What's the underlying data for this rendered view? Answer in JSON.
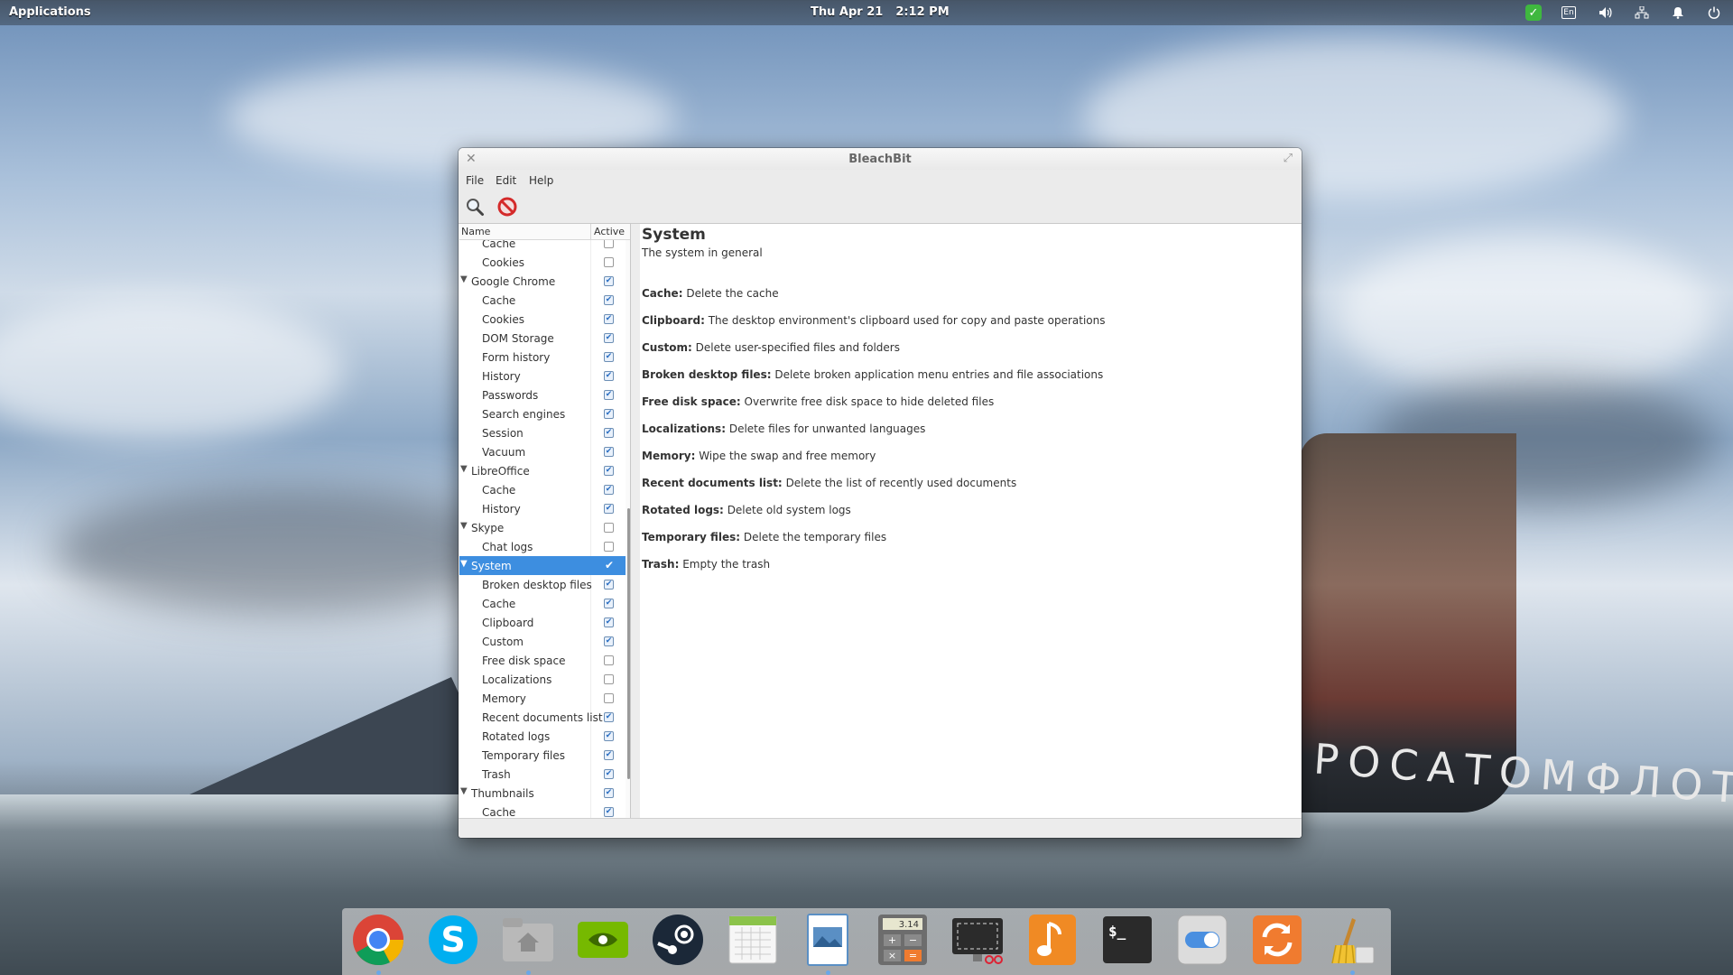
{
  "top_panel": {
    "applications_label": "Applications",
    "date": "Thu Apr 21",
    "time": "2:12 PM",
    "lang_indicator": "En",
    "indicators": [
      "check-icon",
      "keyboard-layout-icon",
      "volume-icon",
      "network-icon",
      "notification-bell-icon",
      "power-icon"
    ]
  },
  "window": {
    "title": "BleachBit",
    "menu": {
      "file": "File",
      "edit": "Edit",
      "help": "Help"
    },
    "toolbar": [
      "preview-search-icon",
      "stop-delete-icon"
    ]
  },
  "tree": {
    "headers": {
      "name": "Name",
      "active": "Active"
    },
    "rows": [
      {
        "label": "Cache",
        "level": 1,
        "checked": false
      },
      {
        "label": "Cookies",
        "level": 1,
        "checked": false
      },
      {
        "label": "Google Chrome",
        "level": 0,
        "expanded": true,
        "checked": true
      },
      {
        "label": "Cache",
        "level": 1,
        "checked": true
      },
      {
        "label": "Cookies",
        "level": 1,
        "checked": true
      },
      {
        "label": "DOM Storage",
        "level": 1,
        "checked": true
      },
      {
        "label": "Form history",
        "level": 1,
        "checked": true
      },
      {
        "label": "History",
        "level": 1,
        "checked": true
      },
      {
        "label": "Passwords",
        "level": 1,
        "checked": true
      },
      {
        "label": "Search engines",
        "level": 1,
        "checked": true
      },
      {
        "label": "Session",
        "level": 1,
        "checked": true
      },
      {
        "label": "Vacuum",
        "level": 1,
        "checked": true
      },
      {
        "label": "LibreOffice",
        "level": 0,
        "expanded": true,
        "checked": true
      },
      {
        "label": "Cache",
        "level": 1,
        "checked": true
      },
      {
        "label": "History",
        "level": 1,
        "checked": true
      },
      {
        "label": "Skype",
        "level": 0,
        "expanded": true,
        "checked": false
      },
      {
        "label": "Chat logs",
        "level": 1,
        "checked": false
      },
      {
        "label": "System",
        "level": 0,
        "expanded": true,
        "checked": true,
        "selected": true
      },
      {
        "label": "Broken desktop files",
        "level": 1,
        "checked": true
      },
      {
        "label": "Cache",
        "level": 1,
        "checked": true
      },
      {
        "label": "Clipboard",
        "level": 1,
        "checked": true
      },
      {
        "label": "Custom",
        "level": 1,
        "checked": true
      },
      {
        "label": "Free disk space",
        "level": 1,
        "checked": false
      },
      {
        "label": "Localizations",
        "level": 1,
        "checked": false
      },
      {
        "label": "Memory",
        "level": 1,
        "checked": false
      },
      {
        "label": "Recent documents list",
        "level": 1,
        "checked": true
      },
      {
        "label": "Rotated logs",
        "level": 1,
        "checked": true
      },
      {
        "label": "Temporary files",
        "level": 1,
        "checked": true
      },
      {
        "label": "Trash",
        "level": 1,
        "checked": true
      },
      {
        "label": "Thumbnails",
        "level": 0,
        "expanded": true,
        "checked": true
      },
      {
        "label": "Cache",
        "level": 1,
        "checked": true
      }
    ]
  },
  "detail": {
    "title": "System",
    "subtitle": "The system in general",
    "options": [
      {
        "name": "Cache:",
        "desc": "Delete the cache"
      },
      {
        "name": "Clipboard:",
        "desc": "The desktop environment's clipboard used for copy and paste operations"
      },
      {
        "name": "Custom:",
        "desc": "Delete user-specified files and folders"
      },
      {
        "name": "Broken desktop files:",
        "desc": "Delete broken application menu entries and file associations"
      },
      {
        "name": "Free disk space:",
        "desc": "Overwrite free disk space to hide deleted files"
      },
      {
        "name": "Localizations:",
        "desc": "Delete files for unwanted languages"
      },
      {
        "name": "Memory:",
        "desc": "Wipe the swap and free memory"
      },
      {
        "name": "Recent documents list:",
        "desc": "Delete the list of recently used documents"
      },
      {
        "name": "Rotated logs:",
        "desc": "Delete old system logs"
      },
      {
        "name": "Temporary files:",
        "desc": "Delete the temporary files"
      },
      {
        "name": "Trash:",
        "desc": "Empty the trash"
      }
    ]
  },
  "dock": {
    "apps": [
      "chrome-icon",
      "skype-icon",
      "home-folder-icon",
      "nvidia-icon",
      "steam-icon",
      "calendar-icon",
      "image-viewer-icon",
      "calculator-icon",
      "screenshot-icon",
      "music-icon",
      "terminal-icon",
      "switchboard-icon",
      "update-icon",
      "bleachbit-icon"
    ],
    "calculator_display": "3.14",
    "terminal_prompt": "$_"
  },
  "colors": {
    "selection": "#3d8ee0",
    "accent_check": "#2b6fc3"
  }
}
